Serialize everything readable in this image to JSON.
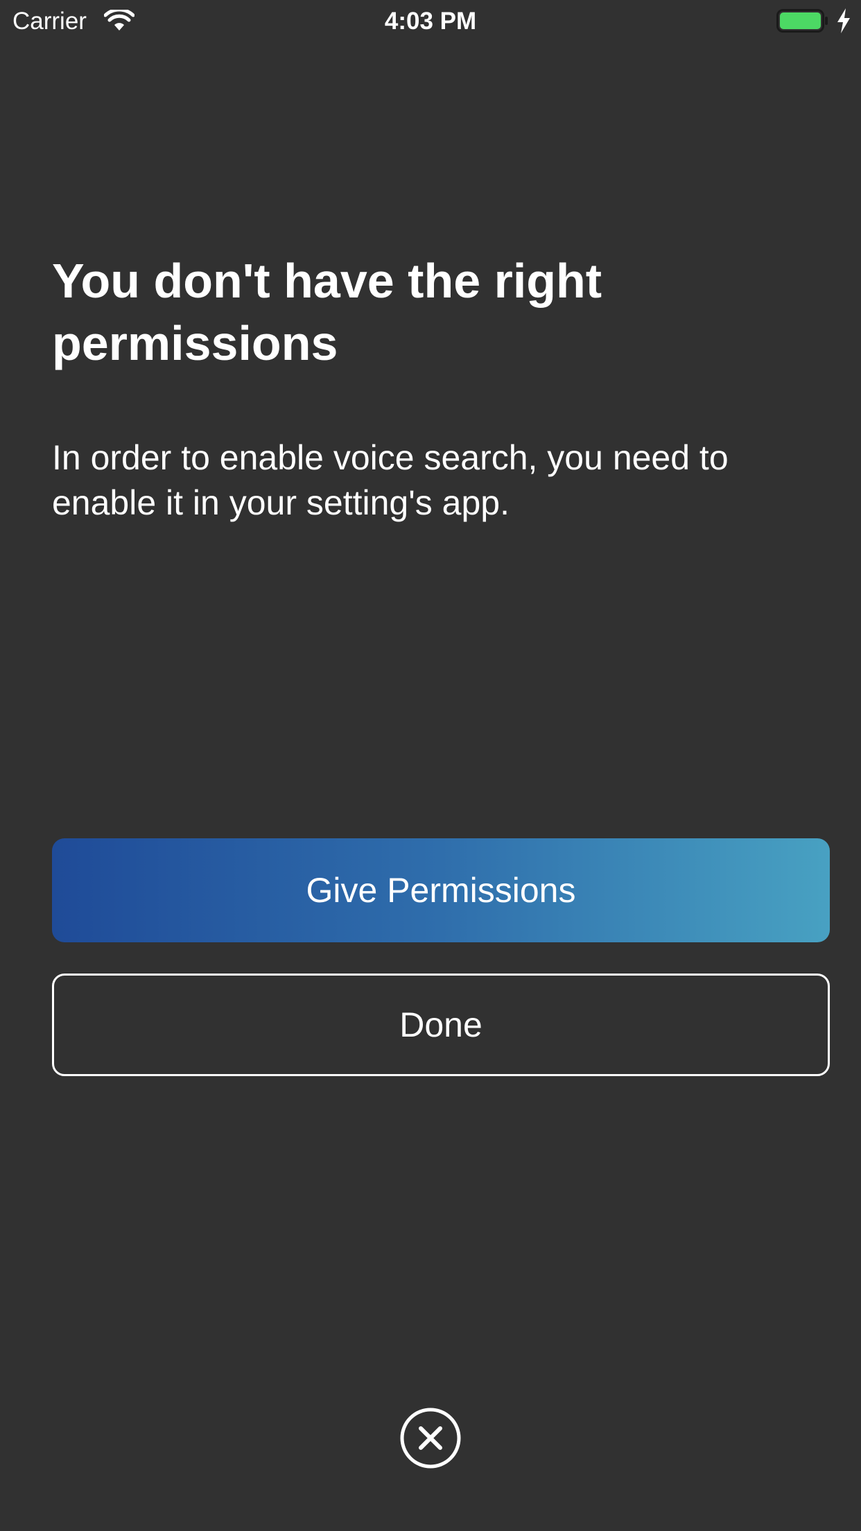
{
  "status_bar": {
    "carrier": "Carrier",
    "time": "4:03 PM",
    "battery_color": "#4cd964"
  },
  "content": {
    "title": "You don't have the right permissions",
    "description": "In order to enable voice search, you need to enable it in your setting's app."
  },
  "actions": {
    "give_permissions_label": "Give Permissions",
    "done_label": "Done"
  },
  "colors": {
    "background": "#313131",
    "gradient_start": "#1f4b98",
    "gradient_end": "#48a1c2",
    "text": "#ffffff"
  },
  "icons": {
    "close": "close-circle-icon",
    "wifi": "wifi-icon",
    "battery": "battery-icon",
    "charging": "charging-bolt-icon"
  }
}
